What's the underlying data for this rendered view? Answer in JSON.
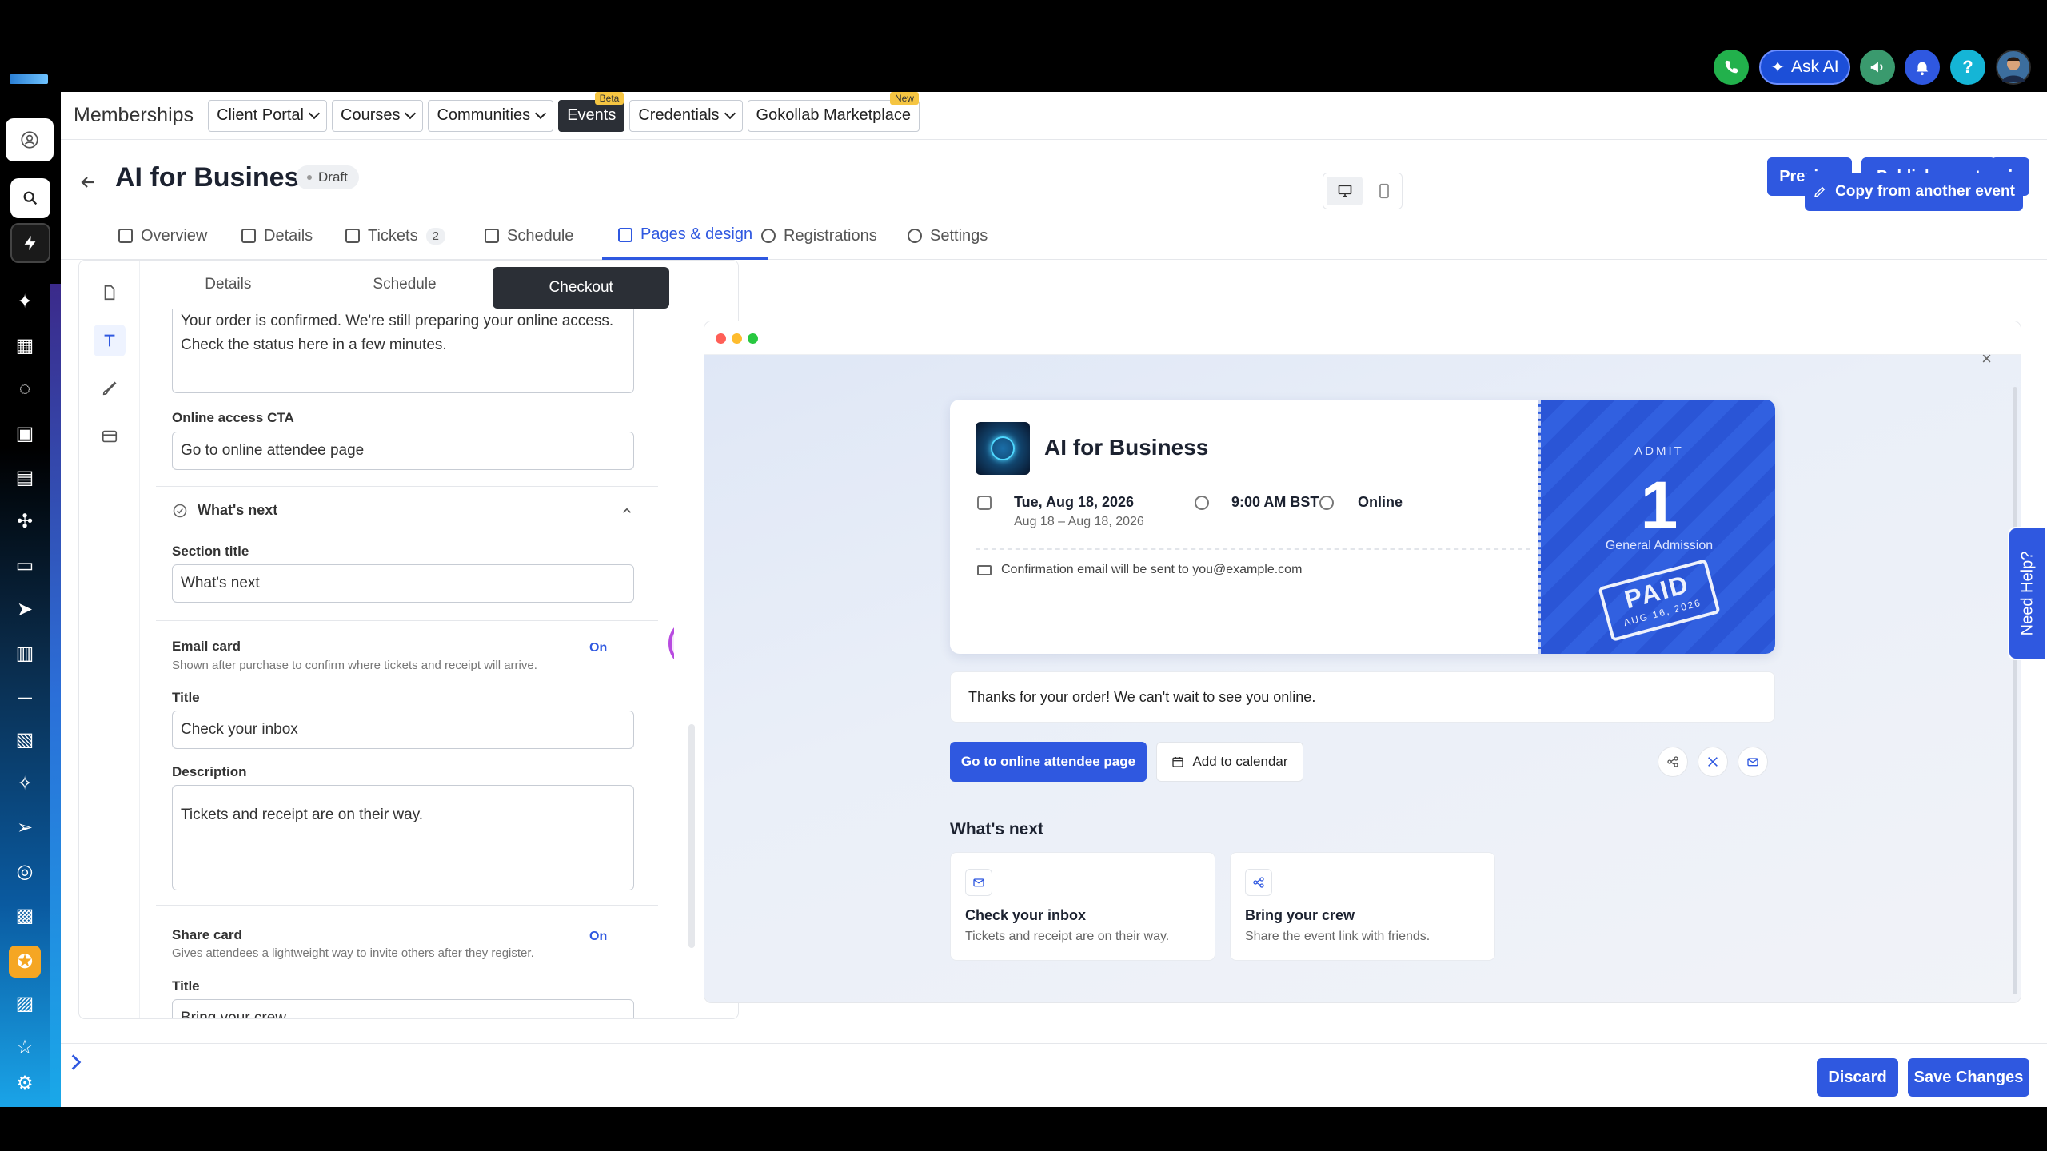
{
  "topbar": {
    "ask_ai_label": "Ask AI",
    "help_glyph": "?",
    "icons": [
      "phone-icon",
      "megaphone-icon",
      "bell-icon",
      "help-icon",
      "avatar"
    ]
  },
  "colors": {
    "accent": "#2f58e0",
    "phone": "#22b14c",
    "help": "#15b5d6",
    "megaphone": "#3a9a6e",
    "bell": "#2f58e0"
  },
  "nav": {
    "title": "Memberships",
    "items": [
      {
        "label": "Client Portal",
        "dropdown": true
      },
      {
        "label": "Courses",
        "dropdown": true
      },
      {
        "label": "Communities",
        "dropdown": true
      },
      {
        "label": "Events",
        "tag": "Beta",
        "active": true
      },
      {
        "label": "Credentials",
        "dropdown": true
      },
      {
        "label": "Gokollab Marketplace",
        "tag": "New"
      }
    ]
  },
  "event": {
    "title": "AI for Business",
    "status": "Draft",
    "preview_label": "Preview",
    "publish_label": "Publish event",
    "more_glyph": "⋮"
  },
  "tabs": [
    {
      "label": "Overview"
    },
    {
      "label": "Details"
    },
    {
      "label": "Tickets",
      "count": "2"
    },
    {
      "label": "Schedule"
    },
    {
      "label": "Pages & design",
      "active": true
    },
    {
      "label": "Registrations"
    },
    {
      "label": "Settings"
    }
  ],
  "editor": {
    "subtabs": [
      "Details",
      "Schedule",
      "Checkout"
    ],
    "active_subtab": "Checkout",
    "online_message": "Your order is confirmed. We're still preparing your online access. Check the status here in a few minutes.",
    "online_cta_label": "Online access CTA",
    "online_cta_value": "Go to online attendee page",
    "whats_next_header": "What's next",
    "section_title_label": "Section title",
    "section_title_value": "What's next",
    "email_card": {
      "title": "Email card",
      "hint": "Shown after purchase to confirm where tickets and receipt will arrive.",
      "state": "On",
      "title_label": "Title",
      "title_value": "Check your inbox",
      "description_label": "Description",
      "description_value": "Tickets and receipt are on their way."
    },
    "share_card": {
      "title": "Share card",
      "hint": "Gives attendees a lightweight way to invite others after they register.",
      "state": "On",
      "title_label": "Title",
      "title_value": "Bring your crew"
    }
  },
  "preview": {
    "copy_label": "Copy from another event",
    "ticket": {
      "name": "AI for Business",
      "date": "Tue, Aug 18, 2026",
      "date_range": "Aug 18 – Aug 18, 2026",
      "time": "9:00 AM BST",
      "location": "Online",
      "confirmation": "Confirmation email will be sent to you@example.com",
      "admit_label": "ADMIT",
      "admit_count": "1",
      "ticket_type": "General Admission",
      "stamp": "PAID",
      "stamp_date": "AUG 16, 2026"
    },
    "thanks": "Thanks for your order! We can't wait to see you online.",
    "go_button": "Go to online attendee page",
    "calendar_button": "Add to calendar",
    "whats_next": "What's next",
    "cards": [
      {
        "title": "Check your inbox",
        "desc": "Tickets and receipt are on their way.",
        "icon": "mail-icon"
      },
      {
        "title": "Bring your crew",
        "desc": "Share the event link with friends.",
        "icon": "share-icon"
      }
    ]
  },
  "need_help": "Need Help?",
  "footer": {
    "discard": "Discard",
    "save": "Save Changes"
  }
}
